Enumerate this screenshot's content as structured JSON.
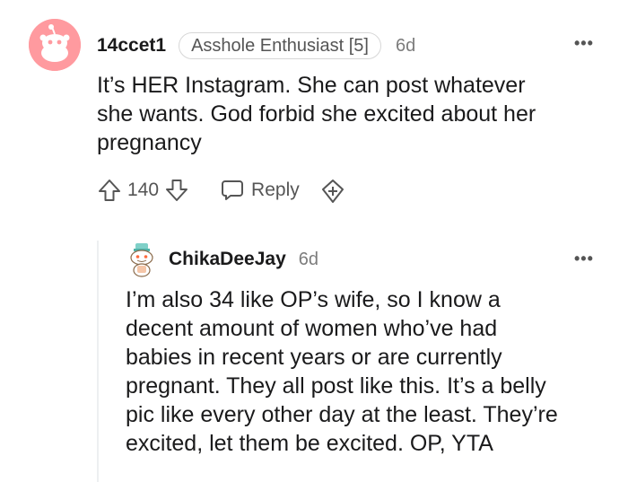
{
  "comment": {
    "username": "14ccet1",
    "flair": "Asshole Enthusiast [5]",
    "time": "6d",
    "more_label": "•••",
    "body_lines": [
      "It’s HER Instagram. She can post whatever",
      "she wants. God forbid she excited about her",
      "pregnancy"
    ],
    "score": "140",
    "reply_label": "Reply",
    "icons": {
      "avatar": "reddit-snoo-avatar",
      "upvote": "upvote-arrow-icon",
      "downvote": "downvote-arrow-icon",
      "reply": "speech-bubble-icon",
      "award": "award-plus-icon",
      "more": "more-options-icon"
    }
  },
  "reply": {
    "username": "ChikaDeeJay",
    "time": "6d",
    "more_label": "•••",
    "body_lines": [
      "I’m also 34 like OP’s wife, so I know a",
      "decent amount of women who’ve had",
      "babies in recent years or are currently",
      "pregnant. They all post like this. It’s a belly",
      "pic like every other day at the least. They’re",
      "excited, let them be excited. OP, YTA"
    ],
    "icons": {
      "avatar": "custom-snoo-avatar",
      "more": "more-options-icon"
    }
  },
  "colors": {
    "avatar_bg": "#ff9a9f",
    "text_primary": "#1a1a1b",
    "text_secondary": "#7c7c7c",
    "thread_line": "#edeff1"
  }
}
